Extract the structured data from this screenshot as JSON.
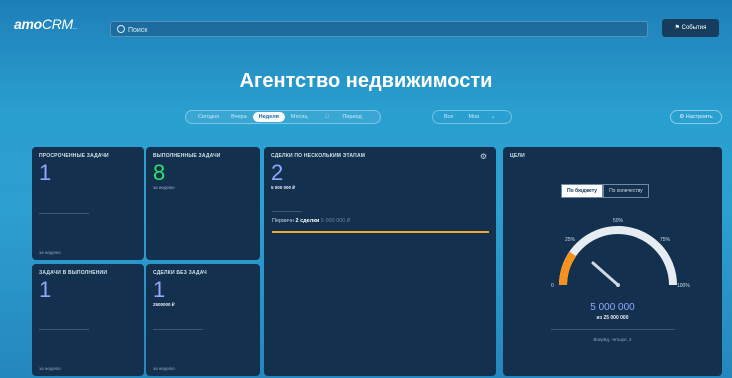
{
  "app": {
    "logo_main": "amo",
    "logo_tail": "CRM",
    "logo_suffix": "..."
  },
  "search": {
    "placeholder": "Поиск"
  },
  "header": {
    "events_label": "События"
  },
  "page_title": "Агентство недвижимости",
  "periods": [
    "Сегодня",
    "Вчера",
    "Неделя",
    "Месяц",
    "Период"
  ],
  "periods_active": 2,
  "filters": [
    "Все",
    "Мои"
  ],
  "settings_label": "Настроить",
  "cards": {
    "overdue": {
      "title": "ПРОСРОЧЕННЫЕ ЗАДАЧИ",
      "value": "1",
      "foot": "за неделю"
    },
    "done": {
      "title": "ВЫПОЛНЕННЫЕ ЗАДАЧИ",
      "value": "8",
      "sub": "за неделю"
    },
    "in_progress": {
      "title": "ЗАДАЧИ В ВЫПОЛНЕНИИ",
      "value": "1",
      "foot": "за неделю"
    },
    "no_tasks": {
      "title": "СДЕЛКИ БЕЗ ЗАДАЧ",
      "value": "1",
      "sub": "2500000 ₽",
      "foot": "за неделю"
    },
    "deals_stage": {
      "title": "СДЕЛКИ ПО НЕСКОЛЬКИМ ЭТАПАМ",
      "value": "2",
      "sub": "5 000 000 ₽",
      "row_label": "Первичн",
      "row_value": "2 сделки",
      "row_extra": "5 000 000 ₽"
    },
    "goal": {
      "title": "ЦЕЛИ",
      "tabs": [
        "По бюджету",
        "По количеству"
      ],
      "tabs_active": 0,
      "scale": [
        "0",
        "25%",
        "50%",
        "75%",
        "100%"
      ],
      "value": "5 000 000",
      "of_label": "из 25 000 000",
      "foot": "Вперёд, четыре, 2"
    }
  },
  "colors": {
    "accent_blue": "#8fa7ff",
    "accent_green": "#2ee06a",
    "gauge_orange": "#f5921e",
    "card_bg": "#13304f"
  },
  "icons": {
    "gear": "gear-icon",
    "search": "search-icon",
    "flag": "flag-icon"
  }
}
